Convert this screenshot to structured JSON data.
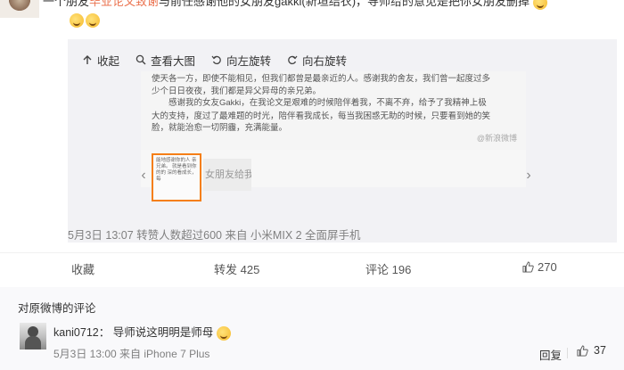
{
  "post": {
    "line1_prefix": "一个朋友",
    "line1_highlight": "毕业论文致谢",
    "line1_suffix": "与前任感谢他的女朋友gakki(新垣结衣)，导师给的意见是把你女朋友删掉",
    "line2": ""
  },
  "repost": {
    "toolbar": [
      {
        "label": "收起",
        "icon": "arrow-up-icon"
      },
      {
        "label": "查看大图",
        "icon": "magnifier-icon"
      },
      {
        "label": "向左旋转",
        "icon": "rotate-left-icon"
      },
      {
        "label": "向右旋转",
        "icon": "rotate-right-icon"
      }
    ],
    "document_lines": [
      "使天各一方，即使不能相见，但我们都曾是最亲近的人。感谢我的舍友，我们曾一起度过多",
      "少个日日夜夜，我们都是异父异母的亲兄弟。",
      "感谢我的女友Gakki，在我论文是艰难的时候陪伴着我，不离不弃，给予了我精神上极",
      "大的支持，度过了最难题的时光，陪伴看我成长，每当我困惑无助的时候，只要看到她的笑",
      "脸，就能治愈一切阴霾，充满能量。"
    ],
    "watermark": "@新浪微博",
    "thumb1_text": "能地感谢你的人 亲兄弟。 就是看到你的的 深的看成长，每",
    "thumb2_text": "女朋友给我",
    "meta": "5月3日 13:07 转赞人数超过600 来自 小米MIX 2 全面屏手机"
  },
  "actions": {
    "favorite": "收藏",
    "repost": "转发 425",
    "comment": "评论 196",
    "like_count": "270"
  },
  "comments": {
    "header": "对原微博的评论",
    "items": [
      {
        "user": "kani0712",
        "text": "：  导师说这明明是师母",
        "meta": "5月3日 13:00 来自 iPhone 7 Plus",
        "reply_label": "回复",
        "like_count": "37"
      }
    ]
  }
}
